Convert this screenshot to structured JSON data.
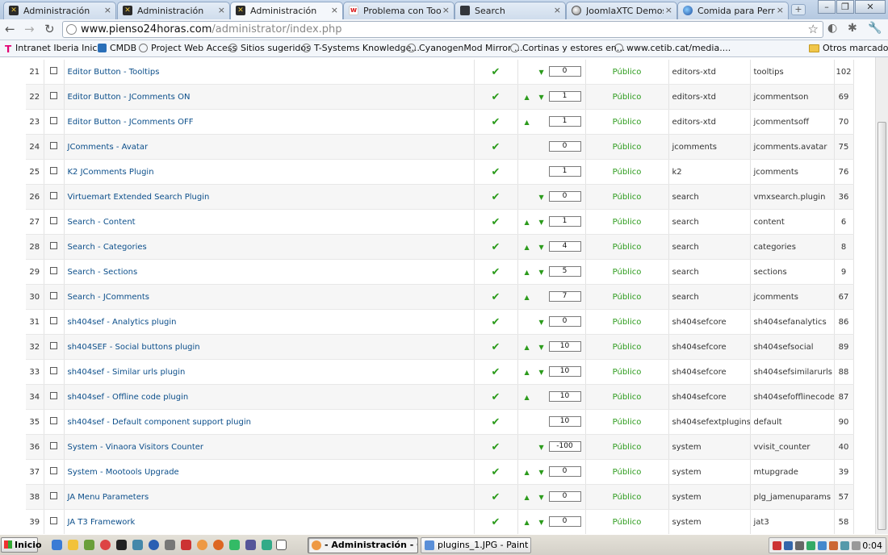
{
  "tabs": [
    {
      "title": "Administración",
      "icon": "joomla-icon"
    },
    {
      "title": "Administración",
      "icon": "joomla-icon"
    },
    {
      "title": "Administración",
      "icon": "joomla-icon"
    },
    {
      "title": "Problema con ToolTips",
      "icon": "w-site-icon"
    },
    {
      "title": "Search",
      "icon": "search-site-icon"
    },
    {
      "title": "JoomlaXTC Demos",
      "icon": "globe-icon"
    },
    {
      "title": "Comida para Perros y G",
      "icon": "blue-globe-icon"
    }
  ],
  "address": {
    "host": "www.pienso24horas.com",
    "path": "/administrator/index.php"
  },
  "bookmarks": [
    {
      "label": "Intranet Iberia Inicio",
      "icon": "t-logo-icon"
    },
    {
      "label": "CMDB",
      "icon": "cmdb-icon"
    },
    {
      "label": "Project Web Access",
      "icon": "globe-icon"
    },
    {
      "label": "Sitios sugeridos",
      "icon": "globe-icon"
    },
    {
      "label": "T-Systems Knowledge...",
      "icon": "globe-icon"
    },
    {
      "label": "CyanogenMod Mirror ...",
      "icon": "globe-icon"
    },
    {
      "label": "Cortinas y estores en...",
      "icon": "globe-icon"
    },
    {
      "label": "www.cetib.cat/media....",
      "icon": "globe-icon"
    }
  ],
  "bookmarks_other": "Otros marcadores",
  "plugins": [
    {
      "num": "21",
      "name": "Editor Button - Tooltips",
      "up": false,
      "down": true,
      "order": "0",
      "access": "Público",
      "type": "editors-xtd",
      "element": "tooltips",
      "id": "102"
    },
    {
      "num": "22",
      "name": "Editor Button - JComments ON",
      "up": true,
      "down": true,
      "order": "1",
      "access": "Público",
      "type": "editors-xtd",
      "element": "jcommentson",
      "id": "69"
    },
    {
      "num": "23",
      "name": "Editor Button - JComments OFF",
      "up": true,
      "down": false,
      "order": "1",
      "access": "Público",
      "type": "editors-xtd",
      "element": "jcommentsoff",
      "id": "70"
    },
    {
      "num": "24",
      "name": "JComments - Avatar",
      "up": false,
      "down": false,
      "order": "0",
      "access": "Público",
      "type": "jcomments",
      "element": "jcomments.avatar",
      "id": "75"
    },
    {
      "num": "25",
      "name": "K2 JComments Plugin",
      "up": false,
      "down": false,
      "order": "1",
      "access": "Público",
      "type": "k2",
      "element": "jcomments",
      "id": "76"
    },
    {
      "num": "26",
      "name": "Virtuemart Extended Search Plugin",
      "up": false,
      "down": true,
      "order": "0",
      "access": "Público",
      "type": "search",
      "element": "vmxsearch.plugin",
      "id": "36"
    },
    {
      "num": "27",
      "name": "Search - Content",
      "up": true,
      "down": true,
      "order": "1",
      "access": "Público",
      "type": "search",
      "element": "content",
      "id": "6"
    },
    {
      "num": "28",
      "name": "Search - Categories",
      "up": true,
      "down": true,
      "order": "4",
      "access": "Público",
      "type": "search",
      "element": "categories",
      "id": "8"
    },
    {
      "num": "29",
      "name": "Search - Sections",
      "up": true,
      "down": true,
      "order": "5",
      "access": "Público",
      "type": "search",
      "element": "sections",
      "id": "9"
    },
    {
      "num": "30",
      "name": "Search - JComments",
      "up": true,
      "down": false,
      "order": "7",
      "access": "Público",
      "type": "search",
      "element": "jcomments",
      "id": "67"
    },
    {
      "num": "31",
      "name": "sh404sef - Analytics plugin",
      "up": false,
      "down": true,
      "order": "0",
      "access": "Público",
      "type": "sh404sefcore",
      "element": "sh404sefanalytics",
      "id": "86"
    },
    {
      "num": "32",
      "name": "sh404SEF - Social buttons plugin",
      "up": true,
      "down": true,
      "order": "10",
      "access": "Público",
      "type": "sh404sefcore",
      "element": "sh404sefsocial",
      "id": "89"
    },
    {
      "num": "33",
      "name": "sh404sef - Similar urls plugin",
      "up": true,
      "down": true,
      "order": "10",
      "access": "Público",
      "type": "sh404sefcore",
      "element": "sh404sefsimilarurls",
      "id": "88"
    },
    {
      "num": "34",
      "name": "sh404sef - Offline code plugin",
      "up": true,
      "down": false,
      "order": "10",
      "access": "Público",
      "type": "sh404sefcore",
      "element": "sh404sefofflinecode",
      "id": "87"
    },
    {
      "num": "35",
      "name": "sh404sef - Default component support plugin",
      "up": false,
      "down": false,
      "order": "10",
      "access": "Público",
      "type": "sh404sefextplugins",
      "element": "default",
      "id": "90"
    },
    {
      "num": "36",
      "name": "System - Vinaora Visitors Counter",
      "up": false,
      "down": true,
      "order": "-100",
      "access": "Público",
      "type": "system",
      "element": "vvisit_counter",
      "id": "40"
    },
    {
      "num": "37",
      "name": "System - Mootools Upgrade",
      "up": true,
      "down": true,
      "order": "0",
      "access": "Público",
      "type": "system",
      "element": "mtupgrade",
      "id": "39"
    },
    {
      "num": "38",
      "name": "JA Menu Parameters",
      "up": true,
      "down": true,
      "order": "0",
      "access": "Público",
      "type": "system",
      "element": "plg_jamenuparams",
      "id": "57"
    },
    {
      "num": "39",
      "name": "JA T3 Framework",
      "up": true,
      "down": true,
      "order": "0",
      "access": "Público",
      "type": "system",
      "element": "jat3",
      "id": "58"
    }
  ],
  "icons": {
    "enabled": "✔",
    "up": "▲",
    "down": "▼"
  },
  "taskbar": {
    "start": "Inicio",
    "tasks": [
      {
        "label": "- Administración - Go...",
        "active": true
      },
      {
        "label": "plugins_1.JPG - Paint",
        "active": false
      }
    ],
    "clock": "0:04"
  },
  "colors": {
    "link": "#0b4e8a",
    "published": "#2c9b1c"
  }
}
